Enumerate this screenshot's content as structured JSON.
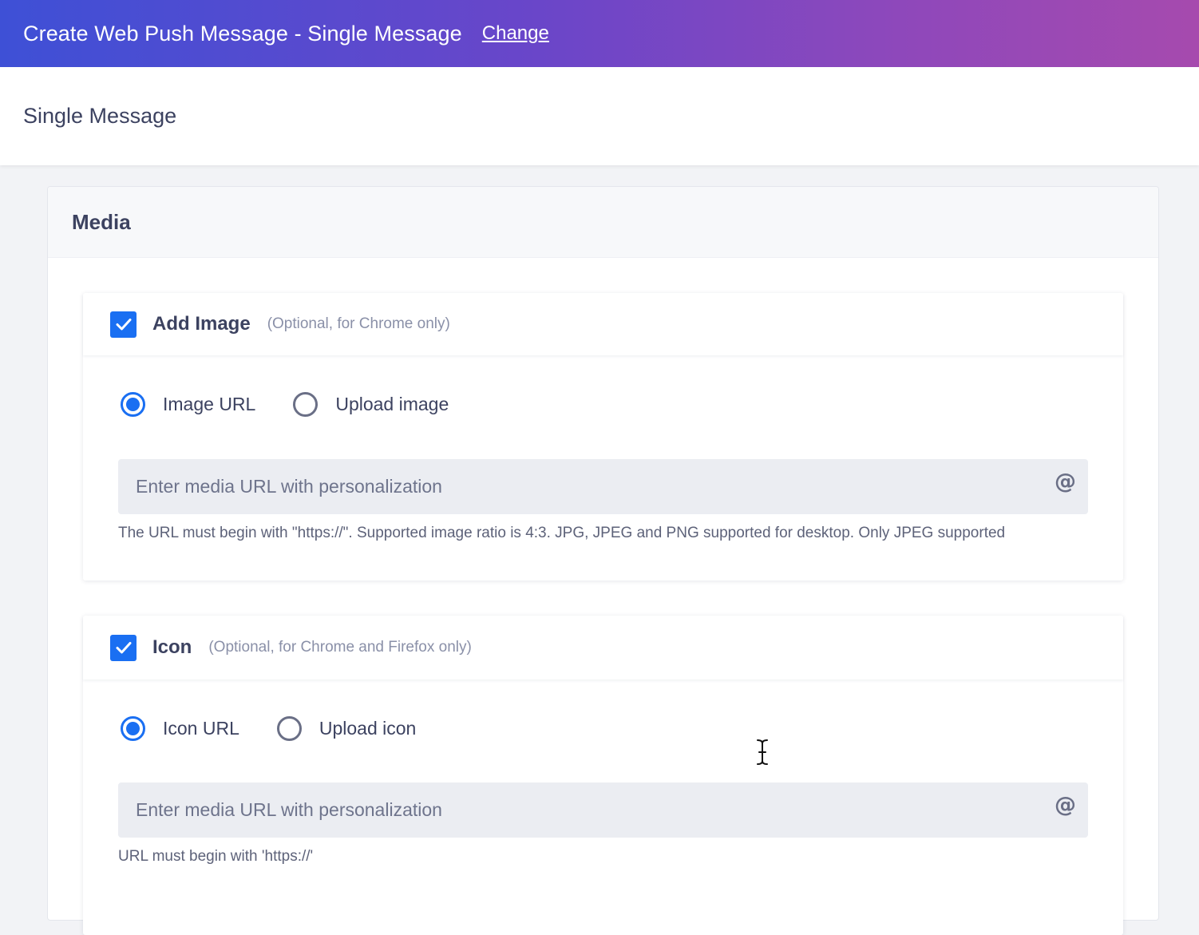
{
  "header": {
    "title": "Create Web Push Message - Single Message",
    "change_link": "Change"
  },
  "subheader": {
    "title": "Single Message"
  },
  "media": {
    "title": "Media",
    "image_section": {
      "checked": true,
      "title": "Add Image",
      "hint": "(Optional, for Chrome only)",
      "options": [
        {
          "label": "Image URL",
          "selected": true
        },
        {
          "label": "Upload image",
          "selected": false
        }
      ],
      "input_placeholder": "Enter media URL with personalization",
      "personalization_symbol": "@",
      "helper_text": "The URL must begin with \"https://\". Supported image ratio is 4:3. JPG, JPEG and PNG supported for desktop. Only JPEG supported"
    },
    "icon_section": {
      "checked": true,
      "title": "Icon",
      "hint": "(Optional, for Chrome and Firefox only)",
      "options": [
        {
          "label": "Icon URL",
          "selected": true
        },
        {
          "label": "Upload icon",
          "selected": false
        }
      ],
      "input_placeholder": "Enter media URL with personalization",
      "personalization_symbol": "@",
      "helper_text": "URL must begin with 'https://'"
    }
  },
  "colors": {
    "accent": "#1a6ff2",
    "header_gradient_start": "#3e50d6",
    "header_gradient_end": "#a64aae"
  }
}
